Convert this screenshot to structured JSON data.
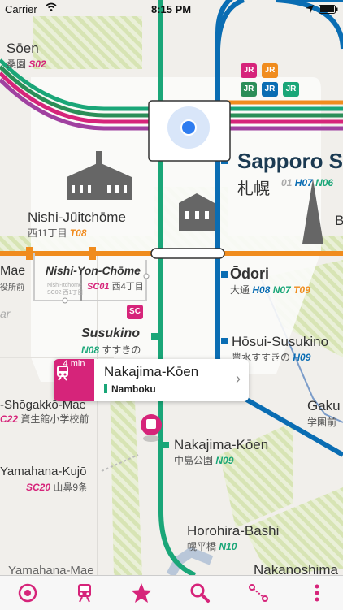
{
  "status": {
    "carrier": "Carrier",
    "time": "8:15 PM"
  },
  "stations": {
    "soen": {
      "en": "Sōen",
      "jp": "桑園",
      "code": "S02"
    },
    "nishi_juitchome": {
      "en": "Nishi-Jūitchōme",
      "jp": "西11丁目",
      "code": "T08"
    },
    "nishi_yon_chome": {
      "en": "Nishi-Yon-Chōme",
      "jp": "西4丁目",
      "code": "SC01"
    },
    "sapporo": {
      "en": "Sapporo S",
      "jp": "札幌",
      "codes": [
        "01",
        "H07",
        "N06"
      ]
    },
    "odori": {
      "en": "Ōdori",
      "jp": "大通",
      "codes": [
        "H08",
        "N07",
        "T09"
      ]
    },
    "susukino": {
      "en": "Susukino",
      "jp": "すすきの",
      "code": "N08"
    },
    "hosui_susukino": {
      "en": "Hōsui-Susukino",
      "jp": "豊水すすきの",
      "code": "H09"
    },
    "nakajima_koen": {
      "en": "Nakajima-Kōen",
      "jp": "中島公園",
      "code": "N09"
    },
    "horohira_bashi": {
      "en": "Horohira-Bashi",
      "jp": "幌平橋",
      "code": "N10"
    },
    "shogakko_mae": {
      "en": "-Shōgakkō-Mae",
      "jp": "資生館小学校前",
      "code": "C22"
    },
    "yamahana_kujo": {
      "en": "Yamahana-Kujō",
      "jp": "山鼻9条",
      "code": "SC20"
    },
    "gaku": {
      "en": "Gaku",
      "jp": "学園前"
    },
    "mae": {
      "en": "Mae",
      "jp": "役所前"
    },
    "nakanoshima": {
      "en": "Nakanoshima"
    },
    "bottom_left": {
      "en": "Yamahana-Mae"
    },
    "b_partial": {
      "en": "B"
    },
    "ar_partial": {
      "en": "ar"
    },
    "nishi_small": {
      "jp": "Nishi-Itchome",
      "code": "SC02 西1丁目"
    }
  },
  "jr_badges": [
    "JR",
    "JR",
    "JR",
    "JR",
    "JR"
  ],
  "sc_badge": "SC",
  "callout": {
    "minutes": "4 min",
    "station": "Nakajima-Kōen",
    "line": "Namboku"
  },
  "colors": {
    "namboku": "#1aa678",
    "tozai": "#f08c1e",
    "toho": "#0a6db3",
    "streetcar": "#2b8e58",
    "pink": "#d6247a",
    "accent": "#d6247a"
  },
  "tabs": [
    {
      "name": "locate-icon"
    },
    {
      "name": "train-icon"
    },
    {
      "name": "star-icon"
    },
    {
      "name": "search-icon"
    },
    {
      "name": "route-icon"
    },
    {
      "name": "more-icon"
    }
  ]
}
